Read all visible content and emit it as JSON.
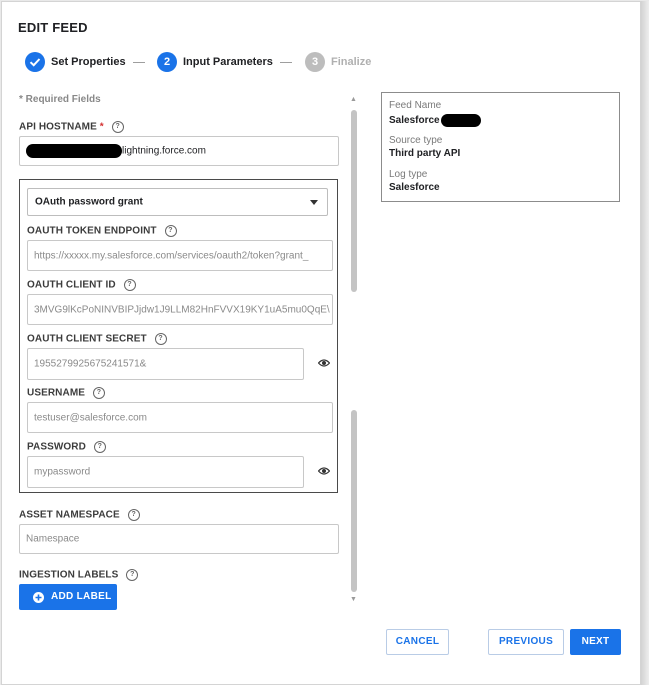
{
  "dialog": {
    "title": "EDIT FEED"
  },
  "stepper": {
    "steps": [
      {
        "number": "✓",
        "label": "Set Properties",
        "state": "complete"
      },
      {
        "number": "2",
        "label": "Input Parameters",
        "state": "active"
      },
      {
        "number": "3",
        "label": "Finalize",
        "state": "pending"
      }
    ],
    "colors": {
      "active": "#1a73e8",
      "pending": "#bdbdbd"
    }
  },
  "form": {
    "required_note": "* Required Fields",
    "api_hostname": {
      "label": "API HOSTNAME",
      "required_mark": "*",
      "value": "lightning.force.com"
    },
    "auth_select": {
      "value": "OAuth password grant"
    },
    "oauth_token_endpoint": {
      "label": "OAUTH TOKEN ENDPOINT",
      "placeholder": "https://xxxxx.my.salesforce.com/services/oauth2/token?grant_"
    },
    "oauth_client_id": {
      "label": "OAUTH CLIENT ID",
      "placeholder": "3MVG9lKcPoNINVBIPJjdw1J9LLM82HnFVVX19KY1uA5mu0QqE\\"
    },
    "oauth_client_secret": {
      "label": "OAUTH CLIENT SECRET",
      "placeholder": "1955279925675241571&"
    },
    "username": {
      "label": "USERNAME",
      "placeholder": "testuser@salesforce.com"
    },
    "password": {
      "label": "PASSWORD",
      "placeholder": "mypassword"
    },
    "asset_namespace": {
      "label": "ASSET NAMESPACE",
      "placeholder": "Namespace"
    },
    "ingestion_labels": {
      "label": "INGESTION LABELS",
      "add_button": "ADD LABEL"
    }
  },
  "summary": {
    "feed_name": {
      "label": "Feed Name",
      "value": "Salesforce"
    },
    "source_type": {
      "label": "Source type",
      "value": "Third party API"
    },
    "log_type": {
      "label": "Log type",
      "value": "Salesforce"
    }
  },
  "footer": {
    "cancel": "CANCEL",
    "previous": "PREVIOUS",
    "next": "NEXT"
  },
  "colors": {
    "accent": "#1a73e8",
    "required": "#d32f2f"
  },
  "icons": {
    "help": "help-circle-icon",
    "eye": "eye-icon",
    "check": "check-icon",
    "dropdown": "caret-down-icon",
    "add": "plus-circle-icon"
  }
}
